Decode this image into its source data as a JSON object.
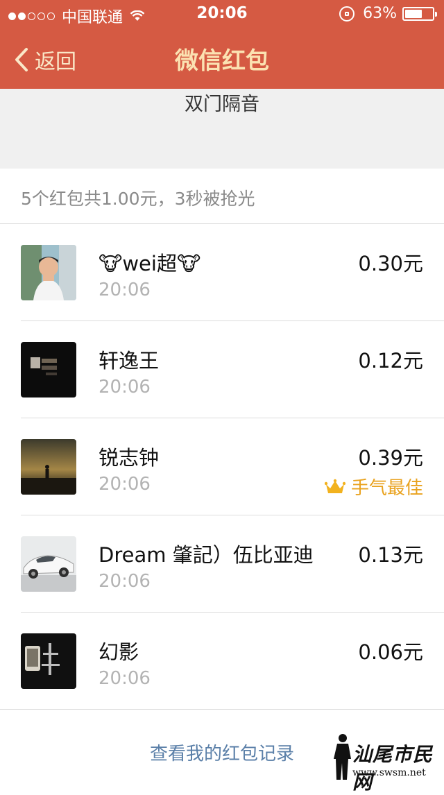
{
  "status": {
    "carrier": "中国联通",
    "time": "20:06",
    "battery": "63%",
    "battery_level": 0.63,
    "signal_bars": 2
  },
  "nav": {
    "back_label": "返回",
    "title": "微信红包"
  },
  "sender": {
    "name": "双门隔音"
  },
  "summary": "5个红包共1.00元，3秒被抢光",
  "records": [
    {
      "name": "🐮wei超🐮",
      "time": "20:06",
      "amount": "0.30元",
      "avatar": "child-photo"
    },
    {
      "name": "轩逸王",
      "time": "20:06",
      "amount": "0.12元",
      "avatar": "dark-text-image"
    },
    {
      "name": "锐志钟",
      "time": "20:06",
      "amount": "0.39元",
      "avatar": "sunset-silhouette",
      "best_label": "手气最佳"
    },
    {
      "name": "Dream 肇記）伍比亚迪",
      "time": "20:06",
      "amount": "0.13元",
      "avatar": "white-car"
    },
    {
      "name": "幻影",
      "time": "20:06",
      "amount": "0.06元",
      "avatar": "phone-hand"
    }
  ],
  "footer_link": "查看我的红包记录",
  "watermark": {
    "text": "汕尾市民网",
    "url": "www.swsm.net"
  },
  "colors": {
    "header": "#d55a43",
    "title": "#fbe2b2",
    "best": "#e9a21e",
    "link": "#5a7fa8"
  }
}
